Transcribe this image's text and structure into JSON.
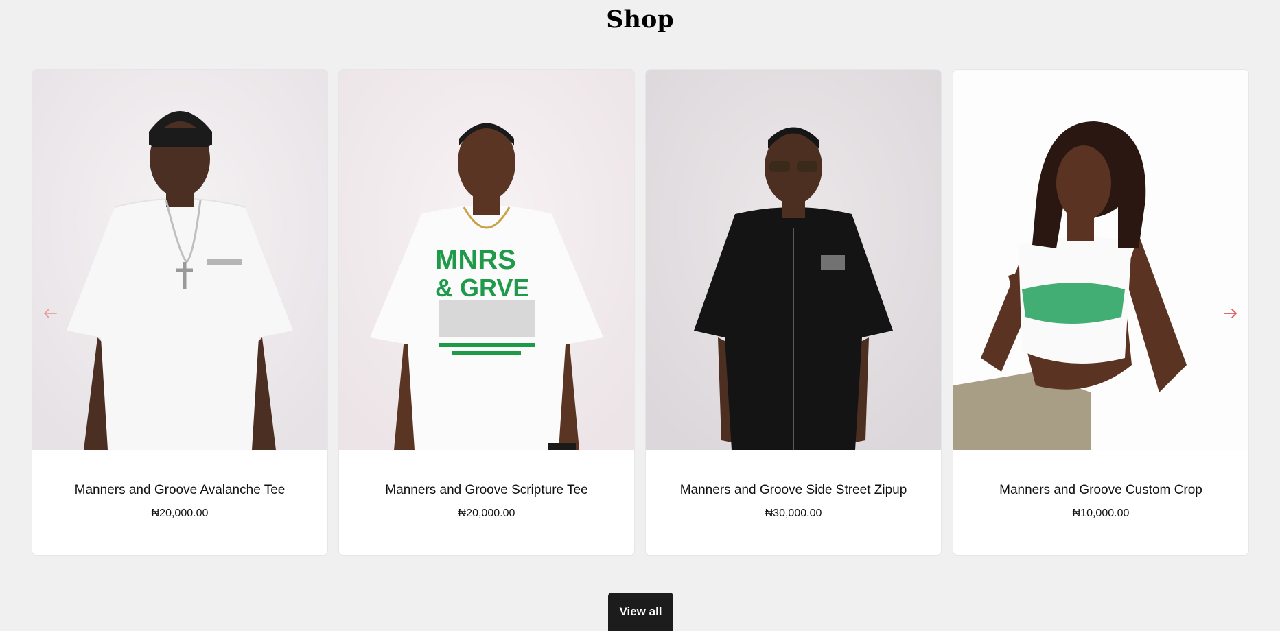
{
  "page": {
    "title": "Shop"
  },
  "colors": {
    "background": "#f0f0f0",
    "card": "#ffffff",
    "arrow": "#e25555",
    "button": "#1c1c1c",
    "button_text": "#ffffff"
  },
  "carousel": {
    "prev_icon": "arrow-left-icon",
    "next_icon": "arrow-right-icon",
    "products": [
      {
        "name": "Manners and Groove Avalanche Tee",
        "price": "₦20,000.00",
        "image": "model in white tee with black beanie"
      },
      {
        "name": "Manners and Groove Scripture Tee",
        "price": "₦20,000.00",
        "image": "model in white tee with green MNRS & GRVE print"
      },
      {
        "name": "Manners and Groove Side Street Zipup",
        "price": "₦30,000.00",
        "image": "model in black zip-up shirt with sunglasses"
      },
      {
        "name": "Manners and Groove Custom Crop",
        "price": "₦10,000.00",
        "image": "model in white crop top with green print"
      }
    ]
  },
  "graphics": {
    "print_top": "MNRS",
    "print_bottom": "& GRVE"
  },
  "actions": {
    "view_all_label": "View all"
  }
}
